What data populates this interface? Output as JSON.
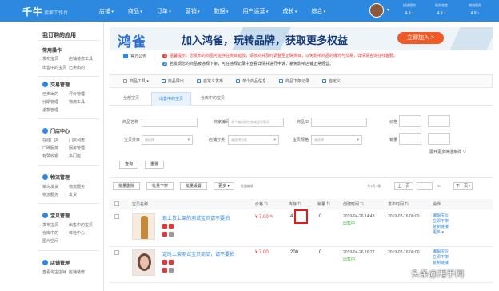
{
  "app": {
    "logo": "千牛",
    "subtitle": "卖家工作台"
  },
  "nav": [
    "店铺",
    "商品",
    "订单",
    "营销",
    "数据",
    "用户运营",
    "成长",
    "综合"
  ],
  "scores": [
    {
      "label": "描述相符",
      "value": "4.9 ↑"
    },
    {
      "label": "服务态度",
      "value": "4.9 ↑"
    },
    {
      "label": "物流服务",
      "value": "4.9 ↑"
    }
  ],
  "sidebar": {
    "title": "我订购的应用",
    "sections": [
      {
        "name": "常用操作",
        "rows": [
          [
            "发布宝贝",
            "店铺装修工具"
          ],
          [
            "出售中的宝贝",
            "已卖出的"
          ]
        ]
      },
      {
        "name": "交易管理",
        "rows": [
          [
            "已卖出的",
            "评价管理"
          ],
          [
            "分期管理",
            "物流工具"
          ],
          [
            "退款管理"
          ]
        ]
      },
      {
        "name": "门店中心",
        "rows": [
          [
            "在线门店",
            "门店列表"
          ],
          [
            "口碑服务",
            "服务管理"
          ],
          [
            "有赞收银",
            "多门店"
          ]
        ]
      },
      {
        "name": "物流管理",
        "rows": [
          [
            "菜鸟发货",
            "物流服务"
          ],
          [
            "物流服务",
            "发货"
          ]
        ]
      },
      {
        "name": "宝贝管理",
        "rows": [
          [
            "发布宝贝",
            "出售中的宝贝"
          ],
          [
            "仓库中的",
            "体检中心"
          ],
          [
            "图片空间"
          ]
        ]
      },
      {
        "name": "店铺管理",
        "rows": [
          [
            "查看淘宝店铺",
            "店铺装修"
          ]
        ]
      }
    ]
  },
  "banner": {
    "logo": "鸿雀",
    "text": "加入鸿雀，玩转品牌，获取更多权益",
    "button": "立即加入 >"
  },
  "notice": {
    "label": "官方公告",
    "lines": [
      "温馨提示：您发布的商品可能存在类目错放，请核对并及时调整至正确类目，以免影响商品的曝光与交易，详情请咨询在线客服。",
      "若发现您的商品被违规下架，可在违规记录中查看详情并进行申诉，避免影响店铺正常经营。"
    ]
  },
  "toolbar": [
    "商品工具",
    "商品导出",
    "自定义发布",
    "单个商品信息",
    "商品下架记录",
    "自定义"
  ],
  "tabs": [
    "全部宝贝",
    "出售中的宝贝",
    "仓库中的宝贝"
  ],
  "filters": {
    "title_label": "商品名称",
    "title_placeholder": "",
    "code_label": "商家编码",
    "code_placeholder": "多个编码用空格或逗号隔开",
    "id_label": "商品ID",
    "id_placeholder": "",
    "price_label": "价格",
    "cat_label": "宝贝类目",
    "cat_value": "请选择",
    "shop_cat_label": "店铺分类",
    "shop_cat_value": "请选择分类",
    "rule_label": "宝贝规格",
    "rule_value": "请选择",
    "sales_label": "销量",
    "more": "展开更多筛选条件",
    "search": "查询",
    "reset": "重置"
  },
  "actions": {
    "buttons": [
      "批量删除",
      "批量下架",
      "批量设置",
      "更多 ▾",
      "批量编辑"
    ],
    "stats": "共1页 2条",
    "prev": "上一页",
    "page": "1/1",
    "next": "下一页"
  },
  "table": {
    "headers": [
      "宝贝名称",
      "价格 ⇅",
      "库存 ⇅",
      "销量 ⇅",
      "创建时间 ⇅",
      "发布时间 ⇅",
      "操作"
    ],
    "rows": [
      {
        "title": "现上货上架的测试宝贝请不要拍",
        "price": "¥ 7.00",
        "stock": "4",
        "sales": "0",
        "created": "2019-04-26 14:48",
        "status": "出售中",
        "published": "2019-07-16 00:00",
        "ops": [
          "编辑宝贝",
          "立即下架",
          "复制链接",
          "更多 ▾"
        ]
      },
      {
        "title": "定时上架测试宝贝商品，请不要拍",
        "price": "¥ 7.00",
        "stock": "200",
        "sales": "0",
        "created": "2019-04-26 16:27",
        "status": "出售中",
        "published": "2019-07-16 00:00",
        "ops": [
          "编辑宝贝",
          "立即下架",
          "复制链接"
        ]
      }
    ]
  },
  "watermark": "头条@甩手网"
}
